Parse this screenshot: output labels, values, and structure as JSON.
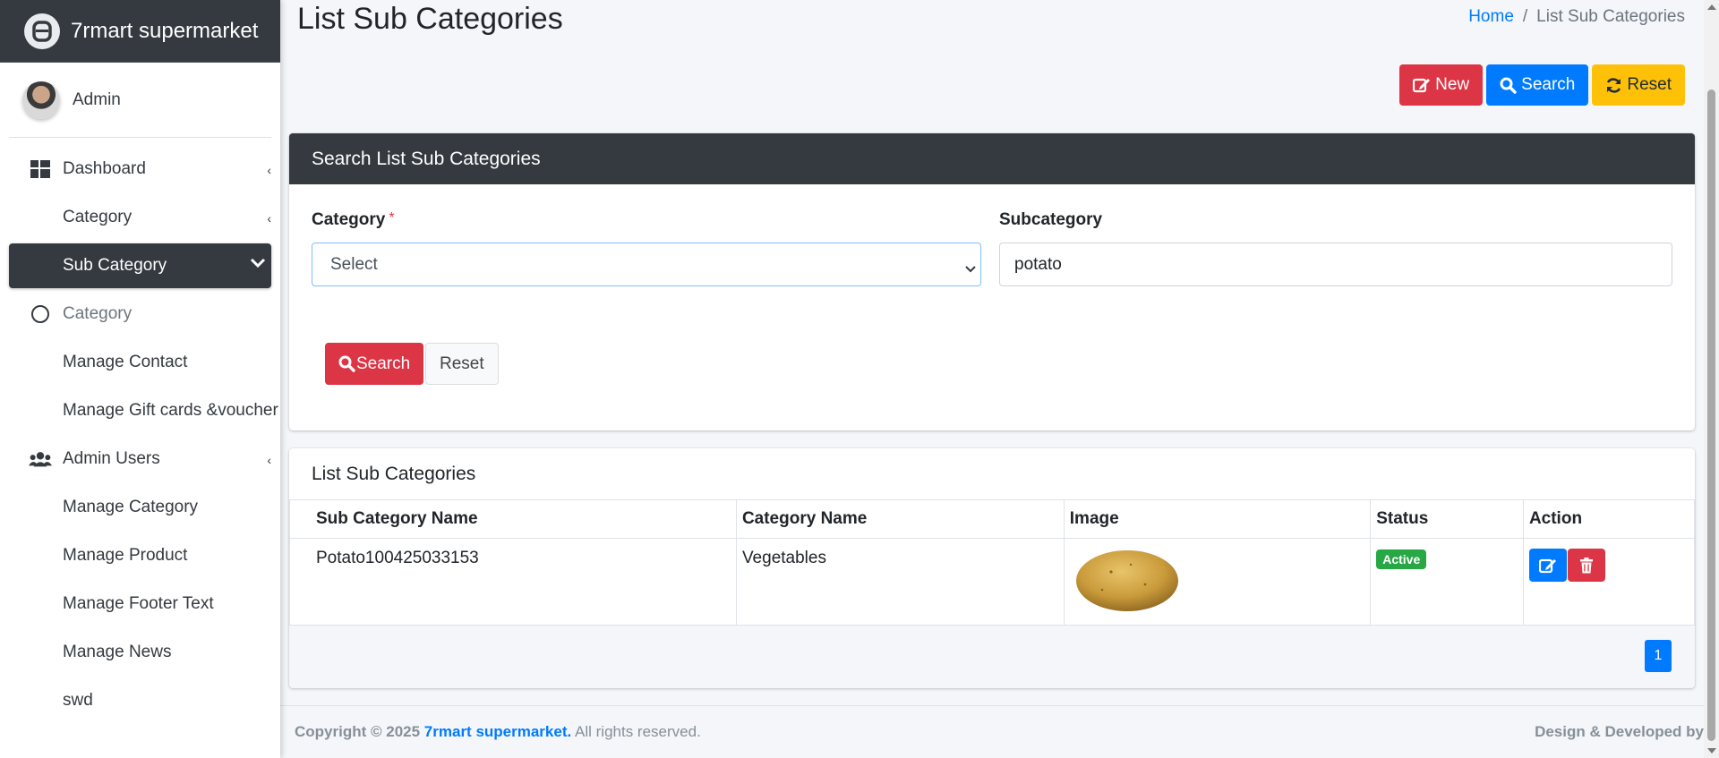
{
  "brand": {
    "name": "7rmart supermarket",
    "logo_icon": "app-logo-icon"
  },
  "user": {
    "name": "Admin"
  },
  "sidebar": {
    "items": [
      {
        "label": "Dashboard",
        "icon": "dashboard-grid-icon"
      },
      {
        "label": "Category"
      },
      {
        "label": "Sub Category",
        "active": true
      },
      {
        "label": "Category",
        "icon": "circle-outline-icon"
      },
      {
        "label": "Manage Contact"
      },
      {
        "label": "Manage Gift cards &voucher"
      },
      {
        "label": "Admin Users",
        "icon": "users-icon"
      },
      {
        "label": "Manage Category"
      },
      {
        "label": "Manage Product"
      },
      {
        "label": "Manage Footer Text"
      },
      {
        "label": "Manage News"
      },
      {
        "label": "swd"
      }
    ]
  },
  "page": {
    "title": "List Sub Categories"
  },
  "breadcrumb": {
    "home": "Home",
    "separator": "/",
    "current": "List Sub Categories"
  },
  "actions": {
    "new": "New",
    "search": "Search",
    "reset": "Reset"
  },
  "search_card": {
    "title": "Search List Sub Categories",
    "category_label": "Category",
    "required_mark": "*",
    "category_value": "Select",
    "subcategory_label": "Subcategory",
    "subcategory_value": "potato",
    "search_button": "Search",
    "reset_button": "Reset"
  },
  "list_card": {
    "title": "List Sub Categories",
    "columns": [
      "Sub Category Name",
      "Category Name",
      "Image",
      "Status",
      "Action"
    ],
    "rows": [
      {
        "sub_category": "Potato100425033153",
        "category": "Vegetables",
        "image": "potato-image",
        "status": "Active"
      }
    ],
    "page": "1"
  },
  "footer": {
    "copyright": "Copyright © 2025",
    "brand": "7rmart supermarket.",
    "rights": "All rights reserved.",
    "right_text": "Design & Developed by"
  },
  "colors": {
    "dark": "#343a40",
    "primary": "#007bff",
    "danger": "#dc3545",
    "warning": "#ffc107",
    "success": "#28a745"
  }
}
